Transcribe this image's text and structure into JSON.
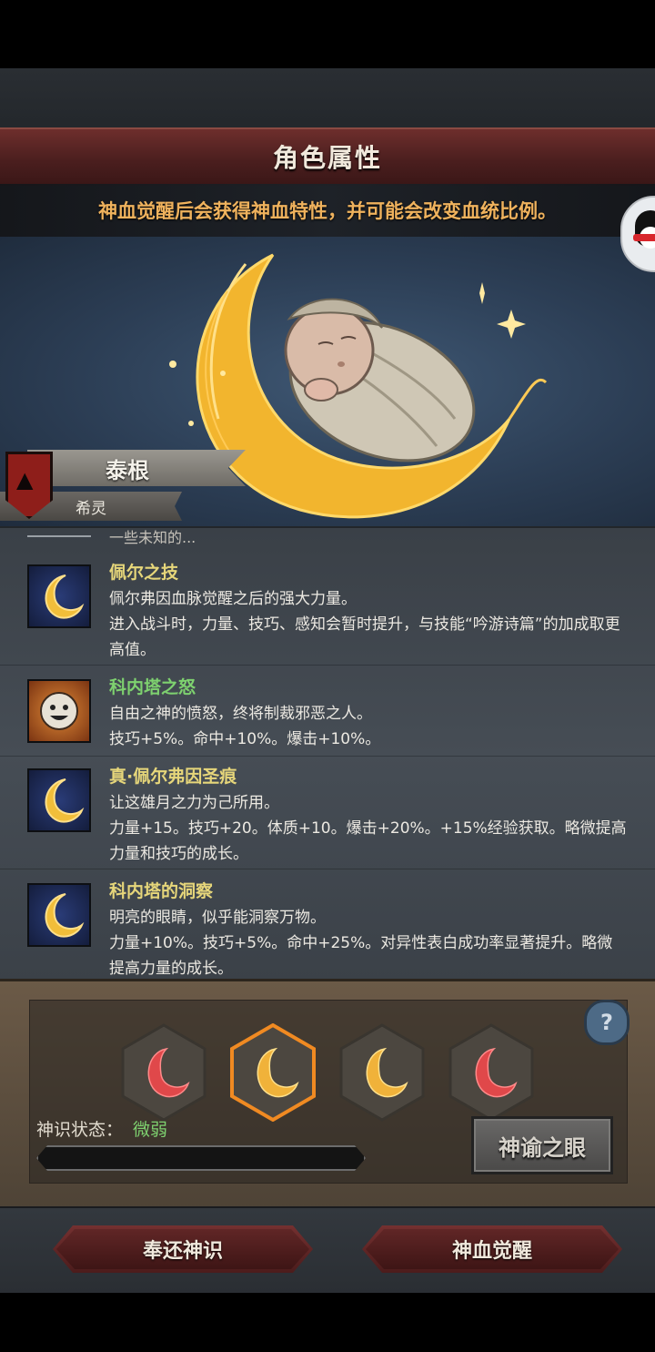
{
  "header": {
    "title": "角色属性"
  },
  "hint": "神血觉醒后会获得神血特性，并可能会改变血统比例。",
  "character": {
    "name": "泰根",
    "lineage": "希灵"
  },
  "cutoff_text": "一些未知的...",
  "traits": [
    {
      "name": "佩尔之技",
      "icon": "crescent-moon-icon",
      "name_color": "yellow",
      "desc": "佩尔弗因血脉觉醒之后的强大力量。\n进入战斗时，力量、技巧、感知会暂时提升，与技能“吟游诗篇”的加成取更高值。"
    },
    {
      "name": "科内塔之怒",
      "icon": "smiling-sun-icon",
      "name_color": "green",
      "desc": "自由之神的愤怒，终将制裁邪恶之人。\n技巧+5%。命中+10%。爆击+10%。"
    },
    {
      "name": "真·佩尔弗因圣痕",
      "icon": "crescent-moon-icon",
      "name_color": "yellow",
      "desc": "让这雄月之力为己所用。\n力量+15。技巧+20。体质+10。爆击+20%。+15%经验获取。略微提高力量和技巧的成长。"
    },
    {
      "name": "科内塔的洞察",
      "icon": "crescent-moon-icon",
      "name_color": "yellow",
      "desc": "明亮的眼睛，似乎能洞察万物。\n力量+10%。技巧+5%。命中+25%。对异性表白成功率显著提升。略微提高力量的成长。"
    }
  ],
  "slots": [
    {
      "name": "red-moon-slot",
      "color": "#e0484a",
      "selected": false
    },
    {
      "name": "gold-moon-slot-selected",
      "color": "#f0b23a",
      "selected": true
    },
    {
      "name": "gold-moon-slot",
      "color": "#f0b23a",
      "selected": false
    },
    {
      "name": "red-moon-slot",
      "color": "#e0484a",
      "selected": false
    }
  ],
  "help_label": "?",
  "status": {
    "label": "神识状态：",
    "value": "微弱",
    "progress": 0.0
  },
  "oracle_button": "神谕之眼",
  "footer": {
    "return_label": "奉还神识",
    "awaken_label": "神血觉醒"
  }
}
